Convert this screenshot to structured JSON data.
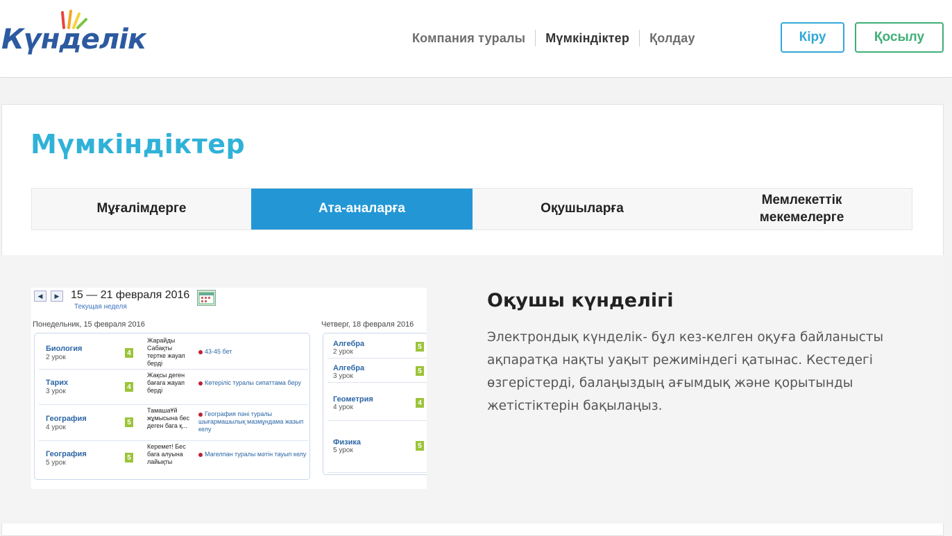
{
  "brand": {
    "logo_text": "Күнделік"
  },
  "nav": {
    "items": [
      {
        "label": "Компания туралы",
        "active": false
      },
      {
        "label": "Мүмкіндіктер",
        "active": true
      },
      {
        "label": "Қолдау",
        "active": false
      }
    ],
    "login_label": "Кіру",
    "join_label": "Қосылу"
  },
  "colors": {
    "accent_blue": "#2397d6",
    "title_cyan": "#30b2d8",
    "login_border": "#31a7d8",
    "join_border": "#3fae77",
    "grade_green": "#9bc43a"
  },
  "page": {
    "title": "Мүмкіндіктер"
  },
  "tabs": [
    {
      "label": "Мұғалімдерге",
      "active": false
    },
    {
      "label": "Ата-аналарға",
      "active": true
    },
    {
      "label": "Оқушыларға",
      "active": false
    },
    {
      "label": "Мемлекеттік мекемелерге",
      "active": false
    }
  ],
  "feature": {
    "title": "Оқушы күнделігі",
    "description": "Электрондық күнделік- бұл кез-келген оқуға байланысты ақпаратқа нақты уақыт режиміндегі қатынас. Кестедегі өзгерістерді, балаңыздың ағымдық және қорытынды жетістіктерін бақылаңыз."
  },
  "mock": {
    "week_range": "15 — 21 февраля 2016",
    "current_week": "Текущая неделя",
    "day1_label": "Понедельник, 15 февраля 2016",
    "day2_label": "Четверг, 18 февраля 2016",
    "day1_lessons": [
      {
        "subject": "Биология",
        "number": "2 урок",
        "grade": "4",
        "comment": "Жарайды Сабақты тертке жауап берді",
        "homework": "43-45 бет"
      },
      {
        "subject": "Тарих",
        "number": "3 урок",
        "grade": "4",
        "comment": "Жақсы деген бағага жауап берді",
        "homework": "Көтеріліс туралы сипаттама беру"
      },
      {
        "subject": "География",
        "number": "4 урок",
        "grade": "5",
        "comment": "ТамашаҰй жұмысына бес деген бага қ...",
        "homework": "География пәні туралы шығармашылық мазмұндама жазып келу"
      },
      {
        "subject": "География",
        "number": "5 урок",
        "grade": "5",
        "comment": "Керемет! Бес бага алуына лайықты",
        "homework": "Магелпан туралы мәтін тауып келу"
      }
    ],
    "day2_lessons": [
      {
        "subject": "Алгебра",
        "number": "2 урок",
        "grade": "5"
      },
      {
        "subject": "Алгебра",
        "number": "3 урок",
        "grade": "5"
      },
      {
        "subject": "Геометрия",
        "number": "4 урок",
        "grade": "4"
      },
      {
        "subject": "Физика",
        "number": "5 урок",
        "grade": "5"
      }
    ]
  }
}
